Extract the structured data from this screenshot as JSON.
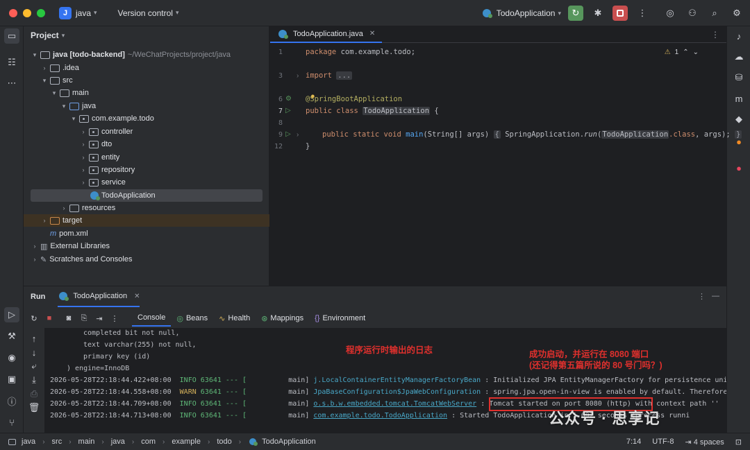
{
  "titlebar": {
    "project_letter": "J",
    "project_name": "java",
    "vcs": "Version control",
    "run_config": "TodoApplication"
  },
  "project_panel": {
    "title": "Project",
    "tree": [
      {
        "label": "java [todo-backend]",
        "suffix": "~/WeChatProjects/project/java"
      },
      {
        "label": ".idea"
      },
      {
        "label": "src"
      },
      {
        "label": "main"
      },
      {
        "label": "java"
      },
      {
        "label": "com.example.todo"
      },
      {
        "label": "controller"
      },
      {
        "label": "dto"
      },
      {
        "label": "entity"
      },
      {
        "label": "repository"
      },
      {
        "label": "service"
      },
      {
        "label": "TodoApplication"
      },
      {
        "label": "resources"
      },
      {
        "label": "target"
      },
      {
        "label": "pom.xml"
      },
      {
        "label": "External Libraries"
      },
      {
        "label": "Scratches and Consoles"
      }
    ]
  },
  "editor": {
    "tab": "TodoApplication.java",
    "line_numbers": [
      "1",
      "3",
      "6",
      "7",
      "8",
      "9",
      "12"
    ],
    "warning_count": "1",
    "code": {
      "l1_kw": "package",
      "l1_rest": " com.example.todo;",
      "l3_kw": "import",
      "l3_fold": "...",
      "l6": "@SpringBootApplication",
      "l7_kw": "public class",
      "l7_name": "TodoApplication",
      "l7_rest": " {",
      "l9_kw": "public static void",
      "l9_fn": "main",
      "l9_args": "(String[] args)",
      "l9_body_open": "{",
      "l9_sa": "SpringApplication.",
      "l9_run": "run",
      "l9_paren": "(",
      "l9_cls": "TodoApplication",
      "l9_class_kw": ".class",
      "l9_tail": ", args);",
      "l9_close": "}",
      "l12": "}"
    }
  },
  "run_panel": {
    "title": "Run",
    "config_tab": "TodoApplication",
    "tabs": [
      "Console",
      "Beans",
      "Health",
      "Mappings",
      "Environment"
    ],
    "console": {
      "ddl": [
        "completed bit not null,",
        "text varchar(255) not null,",
        "primary key (id)",
        ") engine=InnoDB"
      ],
      "logs": [
        {
          "ts": "2026-05-28T22:18:44.422+08:00",
          "level": "INFO",
          "pid": "63641 --- [",
          "thread": "main]",
          "logger": "j.LocalContainerEntityManagerFactoryBean",
          "msg": ": Initialized JPA EntityManagerFactory for persistence uni"
        },
        {
          "ts": "2026-05-28T22:18:44.558+08:00",
          "level": "WARN",
          "pid": "63641 --- [",
          "thread": "main]",
          "logger": "JpaBaseConfiguration$JpaWebConfiguration",
          "msg": ": spring.jpa.open-in-view is enabled by default. Therefore"
        },
        {
          "ts": "2026-05-28T22:18:44.709+08:00",
          "level": "INFO",
          "pid": "63641 --- [",
          "thread": "main]",
          "logger": "o.s.b.w.embedded.tomcat.TomcatWebServer",
          "msg": ": Tomcat started on port 8080 (http) with context path ''"
        },
        {
          "ts": "2026-05-28T22:18:44.713+08:00",
          "level": "INFO",
          "pid": "63641 --- [",
          "thread": "main]",
          "logger": "com.example.todo.TodoApplication",
          "msg": ": Started TodoApplication in 1.692 seconds (process runni"
        }
      ]
    },
    "annotation_log": "程序运行时输出的日志",
    "annotation_started_1": "成功启动，并运行在 8080 端口",
    "annotation_started_2": "(还记得第五篇所说的 80 号门吗？)"
  },
  "statusbar": {
    "crumbs": [
      "java",
      "src",
      "main",
      "java",
      "com",
      "example",
      "todo",
      "TodoApplication"
    ],
    "position": "7:14",
    "encoding": "UTF-8",
    "indent": "4 spaces"
  },
  "watermark": "公众号 · 思享记"
}
